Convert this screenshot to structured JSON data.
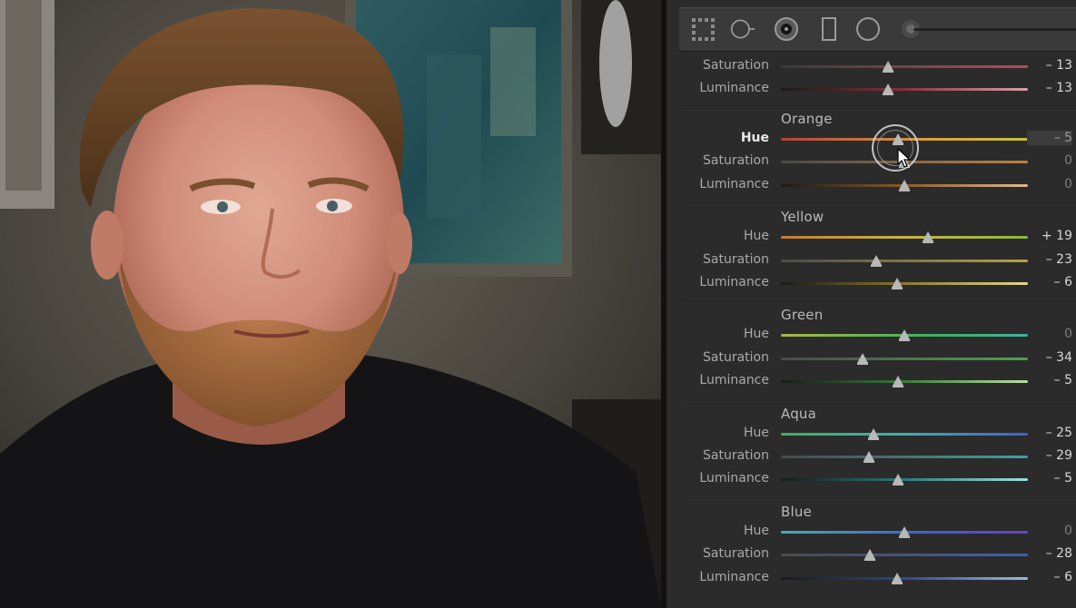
{
  "photo": {
    "description_icon": "portrait-photo"
  },
  "toolbar": {
    "tools": [
      {
        "name": "crop-overlay-grid-icon"
      },
      {
        "name": "spot-removal-icon"
      },
      {
        "name": "red-eye-icon"
      },
      {
        "name": "graduated-filter-icon"
      },
      {
        "name": "radial-filter-icon"
      },
      {
        "name": "adjustment-brush-icon"
      }
    ]
  },
  "hsl": {
    "red_partial": {
      "rows": [
        {
          "label": "Saturation",
          "value": "– 13",
          "pos": -13,
          "gradient": "red-sat"
        },
        {
          "label": "Luminance",
          "value": "– 13",
          "pos": -13,
          "gradient": "red-lum"
        }
      ]
    },
    "sections": [
      {
        "title": "Orange",
        "rows": [
          {
            "label": "Hue",
            "value": "– 5",
            "pos": -5,
            "gradient": "orange-hue",
            "active": true,
            "selected": true
          },
          {
            "label": "Saturation",
            "value": "0",
            "pos": 0,
            "gradient": "orange-sat"
          },
          {
            "label": "Luminance",
            "value": "0",
            "pos": 0,
            "gradient": "orange-lum"
          }
        ]
      },
      {
        "title": "Yellow",
        "rows": [
          {
            "label": "Hue",
            "value": "+ 19",
            "pos": 19,
            "gradient": "yellow-hue"
          },
          {
            "label": "Saturation",
            "value": "– 23",
            "pos": -23,
            "gradient": "yellow-sat"
          },
          {
            "label": "Luminance",
            "value": "– 6",
            "pos": -6,
            "gradient": "yellow-lum"
          }
        ]
      },
      {
        "title": "Green",
        "rows": [
          {
            "label": "Hue",
            "value": "0",
            "pos": 0,
            "gradient": "green-hue"
          },
          {
            "label": "Saturation",
            "value": "– 34",
            "pos": -34,
            "gradient": "green-sat"
          },
          {
            "label": "Luminance",
            "value": "– 5",
            "pos": -5,
            "gradient": "green-lum"
          }
        ]
      },
      {
        "title": "Aqua",
        "rows": [
          {
            "label": "Hue",
            "value": "– 25",
            "pos": -25,
            "gradient": "aqua-hue"
          },
          {
            "label": "Saturation",
            "value": "– 29",
            "pos": -29,
            "gradient": "aqua-sat"
          },
          {
            "label": "Luminance",
            "value": "– 5",
            "pos": -5,
            "gradient": "aqua-lum"
          }
        ]
      },
      {
        "title": "Blue",
        "rows": [
          {
            "label": "Hue",
            "value": "0",
            "pos": 0,
            "gradient": "blue-hue"
          },
          {
            "label": "Saturation",
            "value": "– 28",
            "pos": -28,
            "gradient": "blue-sat"
          },
          {
            "label": "Luminance",
            "value": "– 6",
            "pos": -6,
            "gradient": "blue-lum"
          }
        ]
      }
    ]
  },
  "colors": {
    "panel_bg": "#2b2b2b",
    "label": "#a9a9a9",
    "value": "#d6d6d6"
  }
}
